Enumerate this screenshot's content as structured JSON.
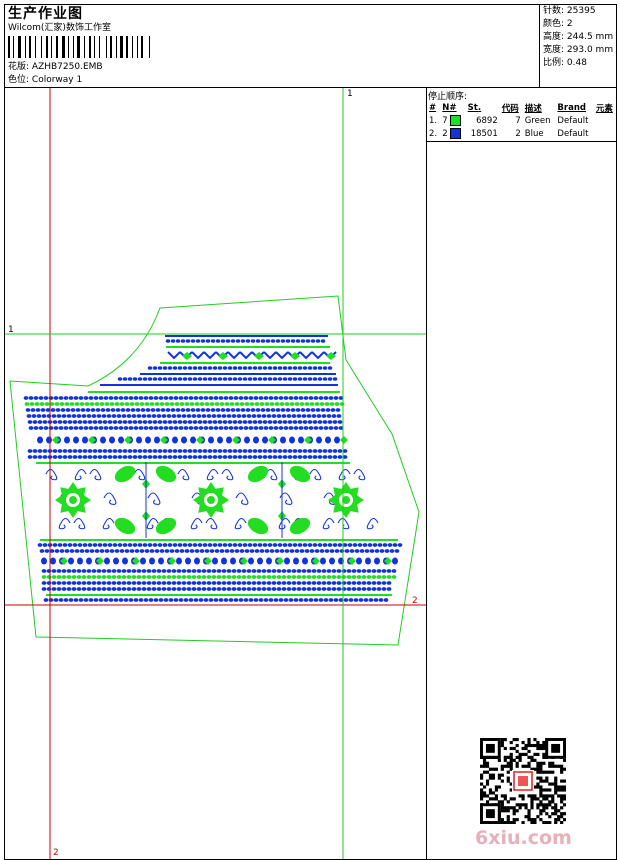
{
  "header": {
    "title": "生产作业图",
    "company": "Wilcom(汇家)数饰工作室",
    "design_label": "花版:",
    "design_value": "AZHB7250.EMB",
    "colorway_label": "色位:",
    "colorway_value": "Colorway 1"
  },
  "stats": [
    {
      "label": "针数:",
      "value": "25395"
    },
    {
      "label": "颜色:",
      "value": "2"
    },
    {
      "label": "高度:",
      "value": "244.5 mm"
    },
    {
      "label": "宽度:",
      "value": "293.0 mm"
    },
    {
      "label": "比例:",
      "value": "0.48"
    }
  ],
  "stops": {
    "title": "停止顺序:",
    "headers": [
      "#",
      "N#",
      "St.",
      "代码",
      "描述",
      "Brand",
      "元素"
    ],
    "rows": [
      {
        "num": "1.",
        "needle": "7",
        "color": "#22dd22",
        "stitches": "6892",
        "code": "7",
        "desc": "Green",
        "brand": "Default"
      },
      {
        "num": "2.",
        "needle": "2",
        "color": "#1133dd",
        "stitches": "18501",
        "code": "2",
        "desc": "Blue",
        "brand": "Default"
      }
    ]
  },
  "guides": {
    "v1": "1",
    "v2": "2",
    "h1": "1",
    "h2": "2"
  },
  "watermark": "6xiu.com",
  "palette": {
    "green": "#22dd22",
    "blue": "#1133dd",
    "guide_red": "#cc0000",
    "guide_green": "#22cc22"
  }
}
